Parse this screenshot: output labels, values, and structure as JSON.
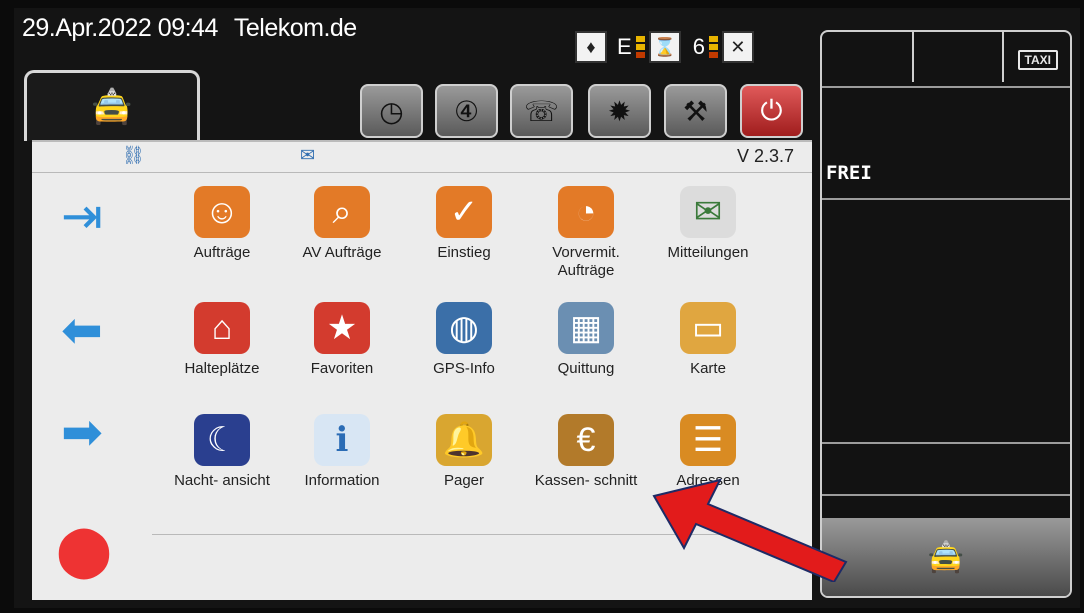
{
  "status": {
    "datetime": "29.Apr.2022 09:44",
    "operator": "Telekom.de",
    "indicator_e": "E",
    "indicator_6": "6"
  },
  "header": {
    "version": "V 2.3.7"
  },
  "grid": {
    "row1": [
      {
        "label": "Aufträge",
        "icon": "person-icon",
        "color": "#e37a27"
      },
      {
        "label": "AV Aufträge",
        "icon": "person-search-icon",
        "color": "#e37a27"
      },
      {
        "label": "Einstieg",
        "icon": "person-check-icon",
        "color": "#e37a27"
      },
      {
        "label": "Vorvermit. Aufträge",
        "icon": "person-clock-icon",
        "color": "#e37a27"
      },
      {
        "label": "Mitteilungen",
        "icon": "envelope-icon",
        "color": "#e9e9e9"
      }
    ],
    "row2": [
      {
        "label": "Halteplätze",
        "icon": "houses-icon",
        "color": "#d33b2e"
      },
      {
        "label": "Favoriten",
        "icon": "house-star-icon",
        "color": "#d33b2e"
      },
      {
        "label": "GPS-Info",
        "icon": "globe-icon",
        "color": "#3b6fa8"
      },
      {
        "label": "Quittung",
        "icon": "cash-register-icon",
        "color": "#6b8fb2"
      },
      {
        "label": "Karte",
        "icon": "card-icon",
        "color": "#e0a640"
      }
    ],
    "row3": [
      {
        "label": "Nacht- ansicht",
        "icon": "monitor-moon-icon",
        "color": "#2a3f8f"
      },
      {
        "label": "Information",
        "icon": "info-icon",
        "color": "#d8e6f4"
      },
      {
        "label": "Pager",
        "icon": "bell-icon",
        "color": "#d9a630"
      },
      {
        "label": "Kassen- schnitt",
        "icon": "money-bag-icon",
        "color": "#b27a2a"
      },
      {
        "label": "Adressen",
        "icon": "address-book-icon",
        "color": "#d98b22"
      }
    ]
  },
  "right_panel": {
    "status_text": "FREI",
    "taxi_sign": "TAXI"
  },
  "colors": {
    "accent_red": "#e21b1b",
    "panel_bg": "#ececec"
  }
}
